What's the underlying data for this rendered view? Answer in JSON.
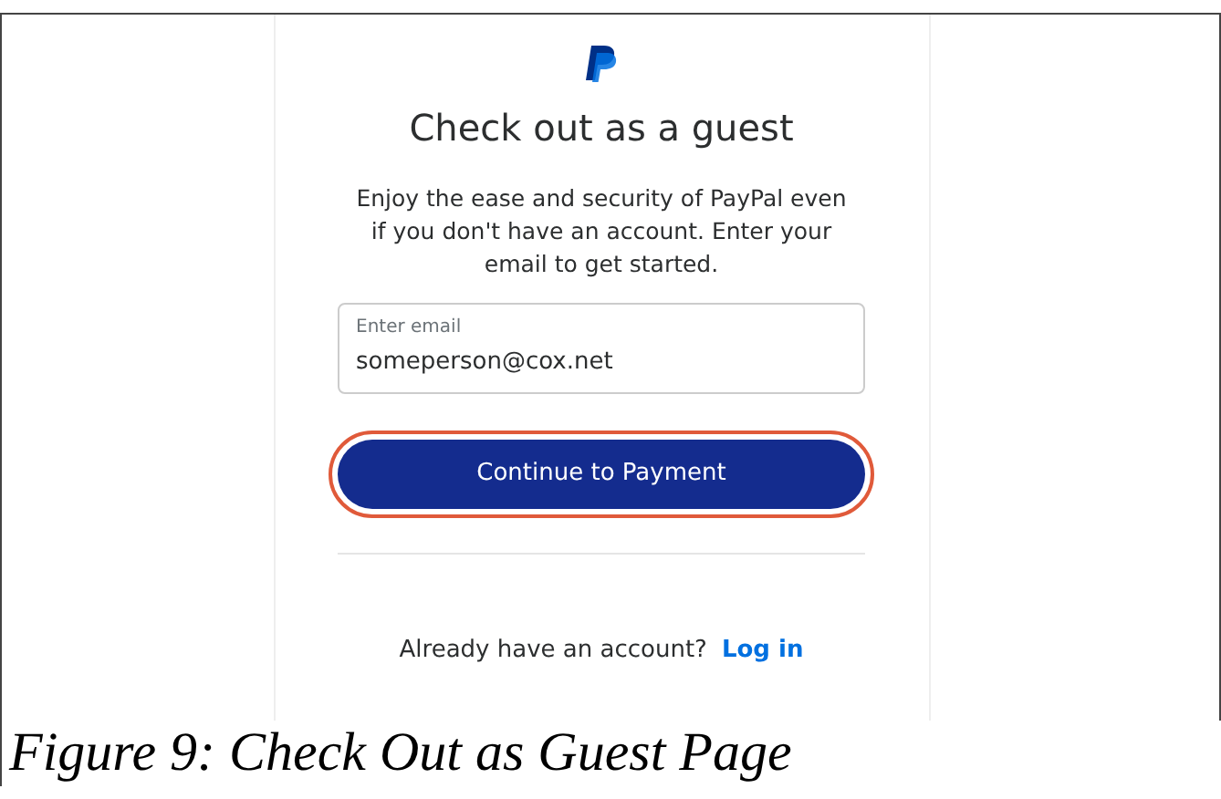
{
  "page": {
    "title": "Check out as a guest",
    "description": "Enjoy the ease and security of PayPal even if you don't have an account. Enter your email to get started.",
    "email_field": {
      "label": "Enter email",
      "value": "someperson@cox.net"
    },
    "continue_button": {
      "label": "Continue to Payment",
      "highlighted": true
    },
    "login_prompt": {
      "text": "Already have an account?",
      "link": "Log in"
    }
  },
  "caption": "Figure 9: Check Out as Guest Page"
}
